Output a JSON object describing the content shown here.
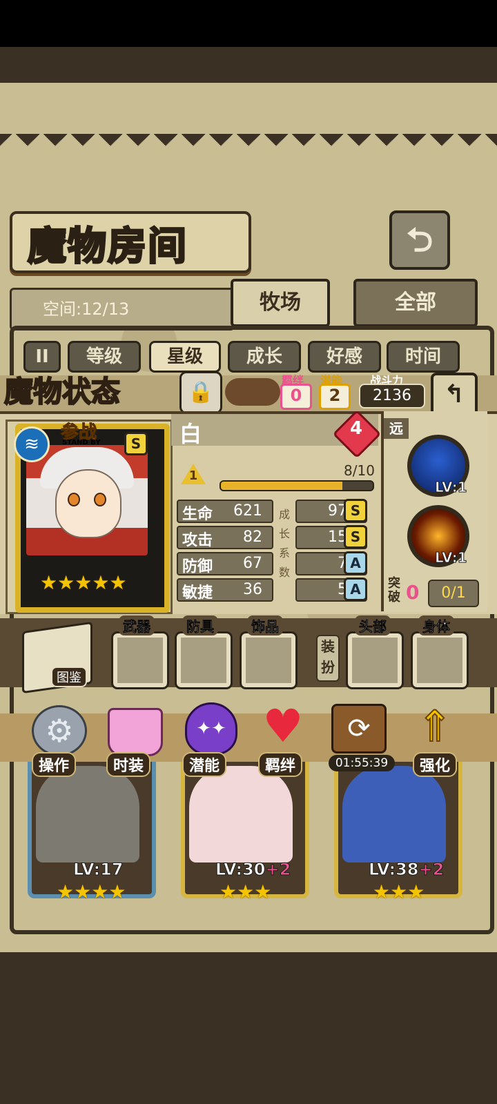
{
  "header": {
    "title": "魔物房间",
    "space_label": "空间:12/13",
    "tabs": [
      {
        "label": "牧场",
        "active": true
      },
      {
        "label": "全部",
        "active": false
      }
    ]
  },
  "filters": {
    "toggle_icon": "II",
    "items": [
      {
        "label": "等级",
        "selected": false
      },
      {
        "label": "星级",
        "selected": true
      },
      {
        "label": "成长",
        "selected": false
      },
      {
        "label": "好感",
        "selected": false
      },
      {
        "label": "时间",
        "selected": false
      }
    ]
  },
  "status": {
    "title": "魔物状态",
    "bond_label": "羁绊",
    "bond_value": "0",
    "potential_label": "潜能",
    "potential_value": "2",
    "power_label": "战斗力",
    "power_value": "2136",
    "character": {
      "name": "白",
      "badge_top": "参战",
      "badge_sub": "STAND BY",
      "rank": "S",
      "stars": 5,
      "heart_value": "4",
      "level_badge": "1",
      "xp_text": "8/10",
      "xp_fraction": 0.8
    },
    "stats": [
      {
        "label": "生命",
        "value": "621",
        "growth": "97.5",
        "grade": "S"
      },
      {
        "label": "攻击",
        "value": "82",
        "growth": "15.5",
        "grade": "S"
      },
      {
        "label": "防御",
        "value": "67",
        "growth": "7.4",
        "grade": "A"
      },
      {
        "label": "敏捷",
        "value": "36",
        "growth": "5.6",
        "grade": "A"
      }
    ],
    "growth_vertical": [
      "成",
      "长",
      "系",
      "数"
    ],
    "range_label": "远",
    "skills": [
      {
        "icon": "wave-skill-icon",
        "level": "LV:1"
      },
      {
        "icon": "fire-sword-skill-icon",
        "level": "LV:1"
      }
    ],
    "breakthrough_label": "突破",
    "breakthrough_value": "0",
    "breakthrough_progress": "0/1"
  },
  "equipment": {
    "codex_label": "图鉴",
    "dress_label": "装扮",
    "slots": [
      "武器",
      "防具",
      "饰品",
      "头部",
      "身体"
    ]
  },
  "actions": [
    {
      "label": "操作",
      "icon": "gear-icon"
    },
    {
      "label": "时装",
      "icon": "outfit-icon"
    },
    {
      "label": "潜能",
      "icon": "demon-icon"
    },
    {
      "label": "羁绊",
      "icon": "hearts-icon"
    },
    {
      "label": "01:55:39",
      "icon": "refresh-chest-icon"
    },
    {
      "label": "强化",
      "icon": "arrows-up-icon"
    }
  ],
  "monsters": [
    {
      "level": "LV:17",
      "plus": "",
      "stars": 4
    },
    {
      "level": "LV:30",
      "plus": "+2",
      "stars": 3
    },
    {
      "level": "LV:38",
      "plus": "+2",
      "stars": 3
    }
  ],
  "colors": {
    "gold": "#d9b227",
    "panel": "#d7cca5",
    "dark": "#3b3121",
    "pink": "#e9528c"
  }
}
